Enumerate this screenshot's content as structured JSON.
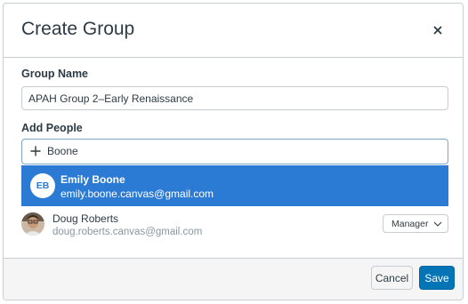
{
  "dialog": {
    "title": "Create Group"
  },
  "group_name": {
    "label": "Group Name",
    "value": "APAH Group 2–Early Renaissance"
  },
  "add_people": {
    "label": "Add People",
    "search_value": "Boone",
    "suggestion": {
      "initials": "EB",
      "name": "Emily Boone",
      "email": "emily.boone.canvas@gmail.com",
      "highlight_color": "#2b7ad4"
    },
    "members": [
      {
        "name": "Doug Roberts",
        "email": "doug.roberts.canvas@gmail.com",
        "role": "Manager"
      }
    ]
  },
  "footer": {
    "cancel_label": "Cancel",
    "save_label": "Save"
  },
  "colors": {
    "primary": "#0374b5",
    "text": "#2d3b45",
    "muted": "#8b969e",
    "border": "#c7cdd1"
  }
}
